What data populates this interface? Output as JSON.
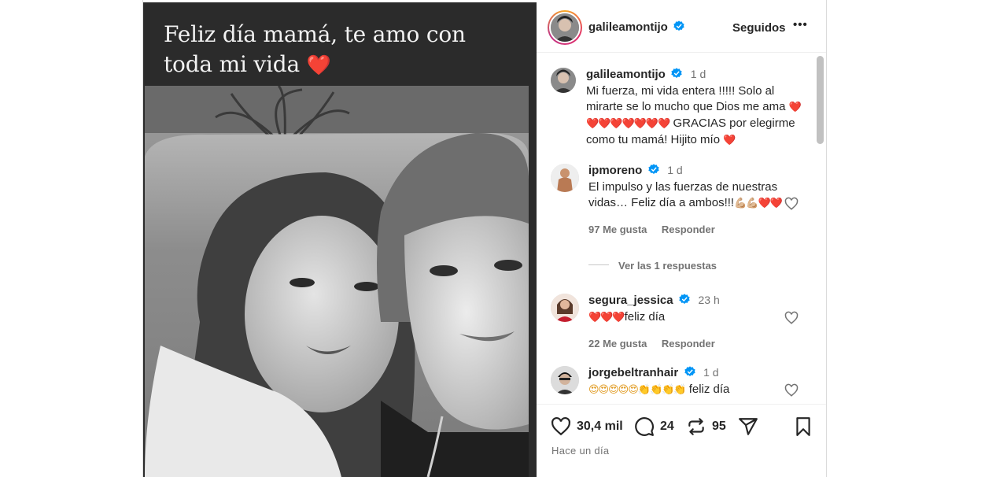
{
  "post": {
    "story_text": "Feliz día mamá, te amo con toda mi vida",
    "story_emoji": "❤️"
  },
  "header": {
    "username": "galileamontijo",
    "follow_state": "Seguidos",
    "more": "•••"
  },
  "caption": {
    "username": "galileamontijo",
    "time": "1 d",
    "text": "Mi fuerza, mi vida entera !!!!! Solo al mirarte se lo mucho que Dios me ama",
    "hearts": "❤️❤️❤️❤️❤️❤️❤️❤️",
    "text2": "GRACIAS por elegirme como tu mamá! Hijito mío",
    "end_emoji": "❤️"
  },
  "comments": [
    {
      "username": "ipmoreno",
      "time": "1 d",
      "text": "El impulso y las fuerzas de nuestras vidas… Feliz día a ambos!!!",
      "emoji": "💪🏼💪🏼❤️❤️",
      "likes": "97 Me gusta",
      "reply": "Responder",
      "view_replies": "Ver las 1 respuestas"
    },
    {
      "username": "segura_jessica",
      "time": "23 h",
      "emoji": "❤️❤️❤️",
      "text": "feliz día",
      "likes": "22 Me gusta",
      "reply": "Responder"
    },
    {
      "username": "jorgebeltranhair",
      "time": "1 d",
      "emoji": "😍😍😍😍😍👏👏👏👏",
      "text": "feliz día"
    }
  ],
  "actions": {
    "likes": "30,4 mil",
    "comments": "24",
    "reposts": "95",
    "posted": "Hace un día"
  },
  "colors": {
    "verified": "#0095f6",
    "text": "#262626",
    "muted": "#737373",
    "heart": "#e0192a"
  }
}
